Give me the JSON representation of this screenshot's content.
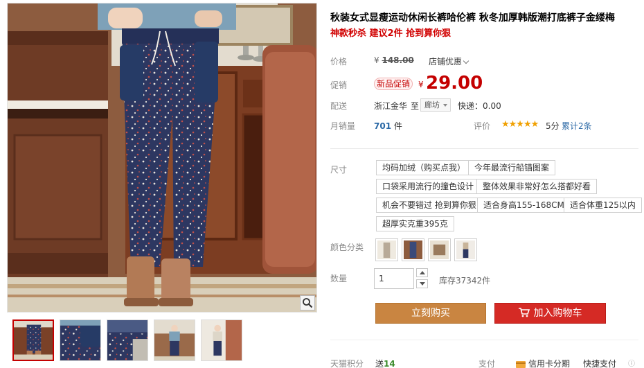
{
  "product": {
    "title": "秋装女式显瘦运动休闲长裤哈伦裤 秋冬加厚韩版潮打底裤子金缕梅",
    "subtitle": "神款秒杀 建议2件 抢到算你狠"
  },
  "price": {
    "label": "价格",
    "currency": "¥",
    "original": "148.00",
    "coupon_label": "店铺优惠"
  },
  "promo": {
    "label": "促销",
    "badge": "新品促销",
    "currency": "¥",
    "price": "29.00"
  },
  "shipping": {
    "label": "配送",
    "from": "浙江金华",
    "to_prefix": "至",
    "to_city": "廊坊",
    "freight": "快递：0.00"
  },
  "sales": {
    "label": "月销量",
    "count": "701",
    "unit": "件",
    "eval_label": "评价",
    "stars": "★★★★★",
    "score": "5分",
    "total_reviews": "累计2条"
  },
  "size": {
    "label": "尺寸",
    "options": [
      "均码加绒（购买点我）",
      "今年最流行船锚图案",
      "口袋采用流行的撞色设计",
      "整体效果非常好怎么搭都好看",
      "机会不要错过 抢到算你狠",
      "适合身高155-168CM",
      "适合体重125以内",
      "超厚实克重395克"
    ]
  },
  "color": {
    "label": "颜色分类"
  },
  "quantity": {
    "label": "数量",
    "value": "1",
    "stock": "库存37342件"
  },
  "buttons": {
    "buy_now": "立刻购买",
    "add_to_cart": "加入购物车"
  },
  "bottom": {
    "points_label": "天猫积分",
    "points_prefix": "送",
    "points_value": "14",
    "pay_label": "支付",
    "credit": "信用卡分期",
    "quick": "快捷支付"
  },
  "colors": {
    "price_red": "#c40000",
    "buy_now_bg": "#c98541",
    "cart_bg": "#d52a25",
    "link_blue": "#2b69a6"
  }
}
